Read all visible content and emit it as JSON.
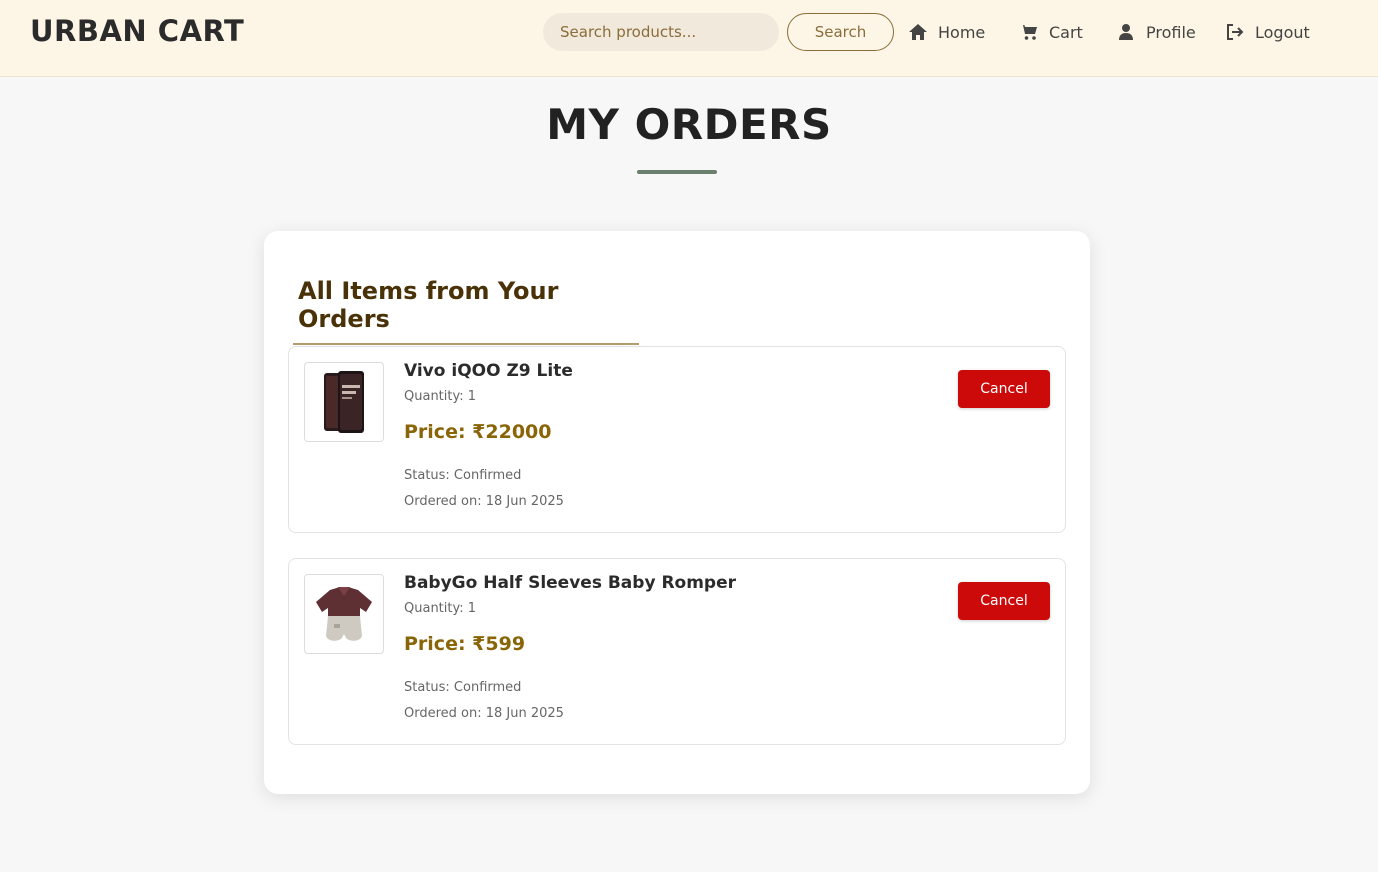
{
  "header": {
    "brand": "URBAN CART",
    "search_placeholder": "Search products...",
    "search_button": "Search",
    "nav": [
      {
        "label": "Home",
        "icon": "home-icon"
      },
      {
        "label": "Cart",
        "icon": "cart-icon"
      },
      {
        "label": "Profile",
        "icon": "user-icon"
      },
      {
        "label": "Logout",
        "icon": "logout-icon"
      }
    ]
  },
  "page": {
    "title": "MY ORDERS"
  },
  "orders": {
    "section_title": "All Items from Your Orders",
    "items": [
      {
        "name": "Vivo iQOO Z9 Lite",
        "quantity": "Quantity: 1",
        "price": "Price: ₹22000",
        "status": "Status: Confirmed",
        "ordered_on": "Ordered on: 18 Jun 2025",
        "cancel_label": "Cancel",
        "image": "phone-image"
      },
      {
        "name": "BabyGo Half Sleeves Baby Romper",
        "quantity": "Quantity: 1",
        "price": "Price: ₹599",
        "status": "Status: Confirmed",
        "ordered_on": "Ordered on: 18 Jun 2025",
        "cancel_label": "Cancel",
        "image": "romper-image"
      }
    ]
  },
  "colors": {
    "header_bg": "#fdf6e6",
    "accent_brown": "#8a6d3b",
    "price": "#8a6508",
    "cancel": "#cc0a0a",
    "title_underline": "#6b7f6e"
  }
}
